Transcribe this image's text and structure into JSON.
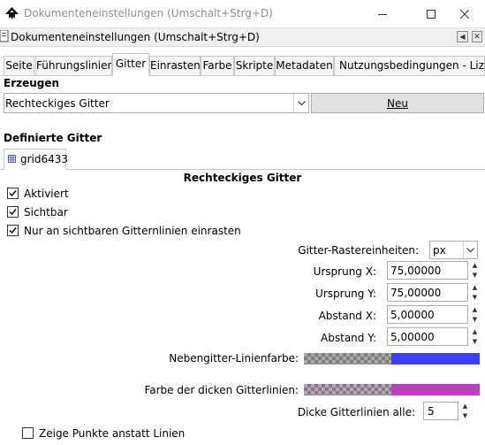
{
  "window": {
    "title": "Dokumenteneinstellungen (Umschalt+Strg+D)",
    "controls": {
      "minimize": "minimize-icon",
      "maximize": "maximize-icon",
      "close": "close-icon"
    }
  },
  "dock": {
    "title": "Dokumenteneinstellungen (Umschalt+Strg+D)",
    "icons": [
      "dock-left-arrow-icon",
      "dock-close-icon"
    ]
  },
  "tabs": [
    {
      "label": "Seite",
      "active": false
    },
    {
      "label": "Führungslinien",
      "active": false
    },
    {
      "label": "Gitter",
      "active": true
    },
    {
      "label": "Einrasten",
      "active": false
    },
    {
      "label": "Farbe",
      "active": false
    },
    {
      "label": "Skripte",
      "active": false
    },
    {
      "label": "Metadaten",
      "active": false
    },
    {
      "label": "Nutzungsbedingungen - Lizenz",
      "active": false
    }
  ],
  "create": {
    "heading": "Erzeugen",
    "grid_type": "Rechteckiges Gitter",
    "new_button": "Neu"
  },
  "defined": {
    "heading": "Definierte Gitter",
    "grid_tab": "grid6433",
    "grid_title": "Rechteckiges Gitter"
  },
  "checkboxes": {
    "enabled": {
      "label": "Aktiviert",
      "checked": true
    },
    "visible": {
      "label": "Sichtbar",
      "checked": true
    },
    "snap_visible": {
      "label": "Nur an sichtbaren Gitternlinien einrasten",
      "checked": true
    },
    "dots": {
      "label": "Zeige Punkte anstatt Linien",
      "checked": false
    }
  },
  "fields": {
    "units": {
      "label": "Gitter-Rastereinheiten:",
      "value": "px"
    },
    "origin_x": {
      "label": "Ursprung X:",
      "value": "75,00000"
    },
    "origin_y": {
      "label": "Ursprung Y:",
      "value": "75,00000"
    },
    "spacing_x": {
      "label": "Abstand X:",
      "value": "5,00000"
    },
    "spacing_y": {
      "label": "Abstand Y:",
      "value": "5,00000"
    },
    "minor_color": {
      "label": "Nebengitter-Linienfarbe:",
      "color": "#3f3fff"
    },
    "major_color": {
      "label": "Farbe der dicken Gitterlinien:",
      "color": "#bf3fbf"
    },
    "major_every": {
      "label": "Dicke Gitterlinien alle:",
      "value": "5"
    }
  }
}
